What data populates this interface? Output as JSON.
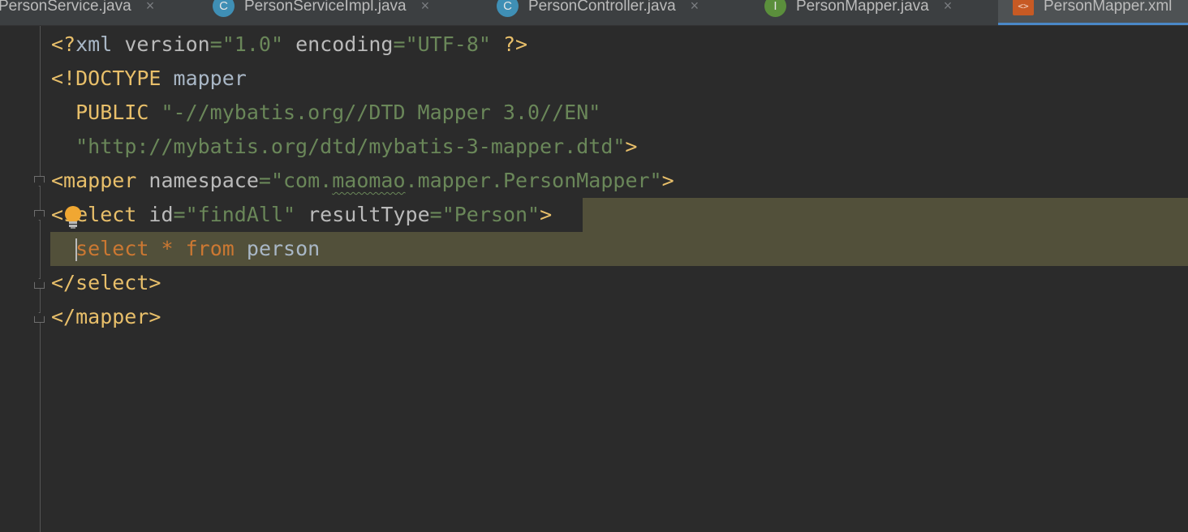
{
  "tabs": [
    {
      "label": "PersonService.java",
      "icon": "interface-icon",
      "active": false
    },
    {
      "label": "PersonServiceImpl.java",
      "icon": "class-icon",
      "active": false
    },
    {
      "label": "PersonController.java",
      "icon": "class-icon",
      "active": false
    },
    {
      "label": "PersonMapper.java",
      "icon": "interface-icon",
      "active": false
    },
    {
      "label": "PersonMapper.xml",
      "icon": "xml-file-icon",
      "active": true
    }
  ],
  "tab_icon_letters": {
    "class": "C",
    "interface": "I",
    "xml": "<>"
  },
  "close_glyph": "×",
  "code": {
    "line1": {
      "p1": "<?",
      "p2": "xml ",
      "p3": "version",
      "p4": "=",
      "p5": "\"1.0\"",
      "p6": " ",
      "p7": "encoding",
      "p8": "=",
      "p9": "\"UTF-8\"",
      "p10": " ?>"
    },
    "line2": {
      "p1": "<!DOCTYPE ",
      "p2": "mapper"
    },
    "line3": {
      "p1": "  PUBLIC ",
      "p2": "\"-//mybatis.org//DTD Mapper 3.0//EN\""
    },
    "line4": {
      "p1": "  ",
      "p2": "\"http://mybatis.org/dtd/mybatis-3-mapper.dtd\"",
      "p3": ">"
    },
    "line5": {
      "p1": "<mapper ",
      "p2": "namespace",
      "p3": "=",
      "p4": "\"com.",
      "p5": "maomao",
      "p6": ".mapper.PersonMapper\"",
      "p7": ">"
    },
    "line6": {
      "p1": "<select ",
      "p2": "id",
      "p3": "=",
      "p4": "\"findAll\"",
      "p5": " ",
      "p6": "resultType",
      "p7": "=",
      "p8": "\"Person\"",
      "p9": ">"
    },
    "line7": {
      "p1": "  ",
      "p2": "select",
      "p3": " ",
      "p4": "*",
      "p5": " ",
      "p6": "from",
      "p7": " ",
      "p8": "person"
    },
    "line8": {
      "p1": "</select>"
    },
    "line9": {
      "p1": "</mapper>"
    }
  },
  "colors": {
    "background": "#2b2b2b",
    "tag": "#e8bf6a",
    "attribute": "#bababa",
    "string": "#6a8759",
    "keyword": "#cc7832",
    "text": "#a9b7c6",
    "highlight": "#52503a",
    "active_tab_underline": "#4a88c7"
  },
  "intention_icon": "lightbulb-icon"
}
